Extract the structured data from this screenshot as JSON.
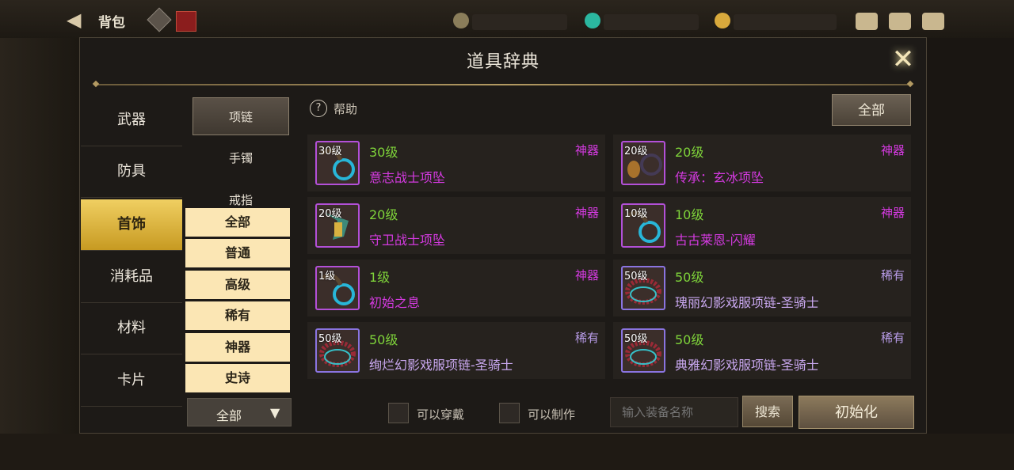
{
  "topbar": {
    "back_icon": "◀",
    "title": "背包",
    "badge_icon": "bag-badge"
  },
  "dialog": {
    "title": "道具辞典",
    "close_icon": "✕"
  },
  "categories": [
    {
      "label": "武器"
    },
    {
      "label": "防具"
    },
    {
      "label": "首饰",
      "active": true
    },
    {
      "label": "消耗品"
    },
    {
      "label": "材料"
    },
    {
      "label": "卡片"
    }
  ],
  "subcategories": [
    {
      "label": "项链",
      "active": true
    },
    {
      "label": "手镯"
    },
    {
      "label": "戒指"
    }
  ],
  "grades": [
    {
      "label": "全部"
    },
    {
      "label": "普通"
    },
    {
      "label": "高级"
    },
    {
      "label": "稀有"
    },
    {
      "label": "神器"
    },
    {
      "label": "史诗"
    }
  ],
  "grade_dropdown": {
    "value": "全部",
    "arrow": "▼"
  },
  "help": {
    "icon": "?",
    "label": "帮助"
  },
  "filter_all_button": "全部",
  "items": [
    {
      "icon_level": "30级",
      "level": "30级",
      "rarity": "神器",
      "name": "意志战士项坠"
    },
    {
      "icon_level": "20级",
      "level": "20级",
      "rarity": "神器",
      "name": "传承：玄冰项坠"
    },
    {
      "icon_level": "20级",
      "level": "20级",
      "rarity": "神器",
      "name": "守卫战士项坠"
    },
    {
      "icon_level": "10级",
      "level": "10级",
      "rarity": "神器",
      "name": "古古莱恩-闪耀"
    },
    {
      "icon_level": "1级",
      "level": "1级",
      "rarity": "神器",
      "name": "初始之息"
    },
    {
      "icon_level": "50级",
      "level": "50级",
      "rarity": "稀有",
      "name": "瑰丽幻影戏服项链-圣骑士"
    },
    {
      "icon_level": "50级",
      "level": "50级",
      "rarity": "稀有",
      "name": "绚烂幻影戏服项链-圣骑士"
    },
    {
      "icon_level": "50级",
      "level": "50级",
      "rarity": "稀有",
      "name": "典雅幻影戏服项链-圣骑士"
    }
  ],
  "footer": {
    "wearable_label": "可以穿戴",
    "craftable_label": "可以制作",
    "search_placeholder": "输入装备名称",
    "search_button": "搜索",
    "reset_button": "初始化"
  },
  "colors": {
    "accent_gold": "#e6bf4a",
    "artifact": "#d43ae0",
    "rare": "#b89ce8",
    "level": "#7fd43a"
  }
}
